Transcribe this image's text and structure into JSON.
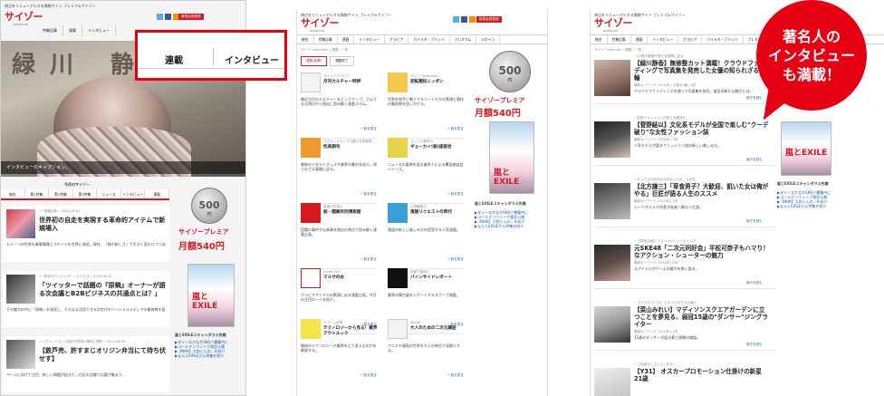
{
  "site": {
    "tagline": "視点をリニューアルする情報サイト プレミアムサイゾー",
    "logo": "サイゾー",
    "logo_sub": "premium",
    "member_button": "新規会員登録",
    "breadcrumb": "サイゾーpremium › 連載 › 一覧"
  },
  "panel1": {
    "nav": [
      "特集記事",
      "連載",
      "インタビュー"
    ],
    "hero_title": "緑川 静香",
    "hero_caption": "インタビューのキャプション。",
    "cat_tabs": [
      "総合",
      "第1特集",
      "第2特集",
      "第3特集",
      "ニュース",
      "インタビュー",
      "連載"
    ],
    "feed_header": "今月のサイゾー",
    "feed": [
      {
        "meta": "──  特集記事  ─  2014.06.30",
        "title": "世界初の自走を実現する革命的アイテムで新規場入",
        "desc": "もう一つの世界の軍事情報とスポーツを世界に発信。現在、「移の新しさ」で大きく変わりつつあるところで、初の手作り作成活動を行った。"
      },
      {
        "meta": "──  新世代クリエイター・ビジネス  ─  2014.06.30",
        "title": "「ツイッターで話題の『原稿』オーナーが語る次会議とB2Bビジネスの共通点とは？」",
        "desc": "その魅力の中に「原稿」を発見し、そのまま活用できる次世代のソーシャルメディアの最前線を語る。"
      },
      {
        "meta": "──  [グラシーマン] 商品を表現の題材に選択  ─  2014.06.30",
        "title": "【鉄芦売、許すまじオリジン弁当にて待ち伏せす】",
        "desc": "ページに向けて注目、新しい問題が起きた。付近の店舗では客が集まり..."
      }
    ],
    "side_links": [
      "▶ダミーなかなかSNSで書籍中に",
      "▶ゴールデンウィーク限定公開",
      "▶【NHK】大和くんの...を紹介",
      "▶なんとEXILEさん特集を紹介"
    ],
    "exile_label": "嵐とEXILEスキャンダラス先端"
  },
  "panel2": {
    "nav": [
      "総合",
      "特集記事",
      "連載",
      "インタビュー",
      "グラビア",
      "パイラタ・ブリッジ",
      "プレミアム",
      "ログイン"
    ],
    "subtabs": [
      "連載(新着)",
      "連載終了"
    ],
    "cards": [
      {
        "cat": "サイゾーグラビア",
        "name": "月刊カルチャー時評",
        "desc": "最近注目のカルチャーをピックアップ。さまざまな視点から独自に読み解く連載コラム。",
        "more": "一覧を見る"
      },
      {
        "cat": "サイゾーpremium",
        "name": "逆転競技ニッポン",
        "desc": "世界を相手に戦うアスリートたちの素顔と競技の最前線を追いかける。",
        "more": "一覧を見る"
      },
      {
        "cat": "アダルトメディアの魅力を再発見",
        "name": "性具期刊",
        "desc": "最新のアダルトグッズや業界の動向を紹介。知られざる裏側に迫る。",
        "more": "一覧を見る"
      },
      {
        "cat": "ゴシップ業界の",
        "name": "ギョーカイ(秘)座談会",
        "desc": "ニュースの裏側を語る業界人による覆面座談会シリーズ。",
        "more": "一覧を見る"
      },
      {
        "cat": "若者が支持の",
        "name": "統・聞業死刑博実語",
        "desc": "話題の事件や出来事を独自の視点で読み解く連載企画。",
        "more": "一覧を見る"
      },
      {
        "cat": "小田編集の",
        "name": "落語リクエストの時代",
        "desc": "落語の新しい楽しみ方を提案する人気連載。",
        "more": "一覧を見る"
      },
      {
        "cat": "Cover Girl",
        "name": "マルサの女",
        "desc": "グラビアアイドルの素顔に迫る連載企画。今月の注目の一人を紹介。",
        "more": "一覧を見る"
      },
      {
        "cat": "佐藤千夏紹介",
        "name": "パインサイドレポート",
        "desc": "業界の舞台裏をレポートするスクープ連載。",
        "more": "一覧を見る"
      },
      {
        "cat": "アラーム記録",
        "name": "テクノロジーから見る！業界アウトルック",
        "desc": "最新のテクノロジーが業界をどう変えるのかを解説する。",
        "more": "一覧を見る"
      },
      {
        "cat": "SKE48",
        "name": "大人のための二次元講座",
        "desc": "アニメや漫画の世界を大人の視点で深掘りする。",
        "more": "一覧を見る"
      }
    ]
  },
  "panel3": {
    "nav": [
      "総合",
      "特集記事",
      "連載",
      "インタビュー",
      "グラビア",
      "パイラタ・ブリッジ",
      "プレミアム",
      "ログイン"
    ],
    "articles": [
      {
        "sub": "─ 25歳の素顔が見せる表情に迫る",
        "title": "【緑川静香】無修整カット満載！クラウドファンディングで写真集を発売した女優の知られざる面輪",
        "meta": "最新キーワード 2014年 | 千葉中2番 | 4件",
        "desc": "クラウドファンディングを使って写真集を発売。彼女の新たな魅力とは。",
        "more": "続きを読む"
      },
      {
        "sub": "─ 芸術ファッションの新たな潮流を",
        "title": "【菅野結以】文化系モデルが全国で楽しむ\"クーデ破り\"な女性ファッション誌",
        "meta": "最新キーワード 2014年 | 3件",
        "desc": "人気モデルが語るファッション誌の新しい楽しみ方。",
        "more": "続きを読む"
      },
      {
        "sub": "─ セックスの旨対の冷めない心の、ものを",
        "title": "【北方謙三】「草食男子？大歓迎、飢いた女は俺がやる」巨匠が語る人生のススメ",
        "meta": "最新キーワード 2014年 | 2件",
        "desc": "ハードボイルド作家が若者へ贈る人生訓。",
        "more": "続きを読む"
      },
      {
        "sub": "─ 【特別企画】 アイドル×シューティング",
        "title": "元SKE48「二次元同好会」平松可奈子もハマり！なアクション・シューターの魅力",
        "meta": "最新キーワード 2014年 | 5件",
        "desc": "元アイドルがゲームの魅力を熱く語る。",
        "more": "続きを読む"
      },
      {
        "sub": "─ 【テラスハウス】 とのコラボでも出演の",
        "title": "【菜山みれい】マディソンスクエアガーデンに立つことを夢見る、弱冠15歳の\"ダンサー\"ジングライター",
        "meta": "最新キーワード 2014年 | 1件",
        "desc": "15歳のダンサーが語る夢と挑戦の物語。",
        "more": "続きを読む"
      },
      {
        "sub": "─ この謎らしさにどこまで！",
        "title": "【Y31】 オスカープロモーション仕掛けの新星21歳",
        "meta": "",
        "desc": "",
        "more": ""
      }
    ]
  },
  "callout": {
    "item1": "連載",
    "item2": "インタビュー"
  },
  "bubble": {
    "line1": "著名人の",
    "line2": "インタビュー",
    "line3": "も満載！"
  },
  "ad": {
    "coin": "500",
    "coin_unit": "円",
    "premium": "サイゾープレミア",
    "price": "月額540円",
    "mag": "嵐とEXILE"
  },
  "colors": {
    "brand": "#d71920",
    "highlight": "#e60012",
    "link": "#1a5ca8"
  }
}
